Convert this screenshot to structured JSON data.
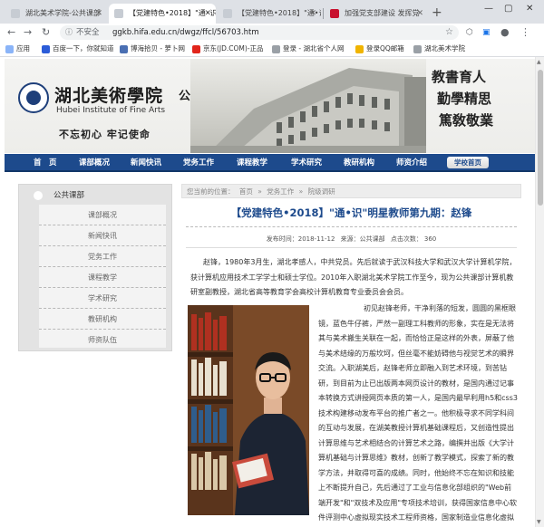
{
  "browser": {
    "tabs": [
      {
        "title": "湖北美术学院-公共课部",
        "active": false
      },
      {
        "title": "【党建特色•2018】\"通•识",
        "active": true
      },
      {
        "title": "【党建特色•2018】\"通•识",
        "active": false
      },
      {
        "title": "加强党支部建设 发挥党",
        "active": false
      }
    ],
    "address": {
      "security": "不安全",
      "url": "ggkb.hifa.edu.cn/dwgz/ffcl/56703.htm"
    },
    "bookmarks": [
      "应用",
      "百度一下，你就知道",
      "博海拾贝 - 萝卜网",
      "京东(JD.COM)-正品",
      "登录 - 湖北省个人网",
      "登录QQ邮箱",
      "湖北美术学院"
    ]
  },
  "header": {
    "school_cn": "湖北美術學院",
    "school_en": "Hubei Institute of Fine Arts",
    "dept": "公共课部",
    "slogan": "不忘初心   牢记使命",
    "motto": [
      "教書育人",
      "勤學精思",
      "篤敎敬業"
    ]
  },
  "nav": [
    "首　页",
    "课部概况",
    "新闻快讯",
    "党务工作",
    "课程教学",
    "学术研究",
    "教研机构",
    "师资介绍",
    "学校首页"
  ],
  "sidebar": {
    "title": "公共课部",
    "items": [
      "课部概况",
      "新闻快讯",
      "党务工作",
      "课程教学",
      "学术研究",
      "教研机构",
      "师资队伍"
    ]
  },
  "breadcrumb": {
    "prefix": "您当前的位置：",
    "items": [
      "首页",
      "党务工作",
      "院级调研"
    ],
    "sep": "»"
  },
  "article": {
    "title": "【党建特色•2018】\"通•识\"明星教师第九期：赵锋",
    "meta": {
      "date": "发布时间：2018-11-12",
      "source": "来源：公共课部",
      "views_label": "点击次数：",
      "views": "360"
    },
    "p1": "赵锋，1980年3月生，湖北孝感人，中共党员。先后就读于武汉科技大学和武汉大学计算机学院，获计算机应用技术工学学士和硕士学位。2010年入职湖北美术学院工作至今，现为公共课部计算机教研室副教授，湖北省高等教育学会高校计算机教育专业委员会会员。",
    "p2": "初见赵锋老师，干净利落的短发，圆圆的黑框眼镜，蓝色牛仔裤，严然一副理工科教师的形象，实在是无法将其与美术搬生关联在一起，而恰恰正是这样的外表，屏蔽了他与美术结缘的万般坎坷，但丝毫不能妨碍他与视觉艺术的瞬界交流。入职湖美后，赵锋老师立即融入到艺术环境，到苦钻研，到目前为止已出版两本网页设计的教材，是国内通过记事本转换方式讲授网页本质的第一人，是国内最早利用h5和css3技术构建移动发布平台的推广者之一。他积极寻求不同学科间的互动与发展，在湖美教授计算机基础课程后，又创造性提出计算思维与艺术相结合的计算艺术之路，编撰并出版《大学计算机基础与计算思维》教材，创新了教学模式，探索了新的教学方法，并取得可喜的成绩。同时，他始终不忘在知识和技能上不断提升自己，先后通过了工业与信息化部组织的\"Web前端开发\"和\"双技术及应用\"专项技术培训，获得国家信息中心软件评测中心虚拟现实技术工程师资格，国家制造业信息化虚拟现实技术培训讲师。"
  }
}
